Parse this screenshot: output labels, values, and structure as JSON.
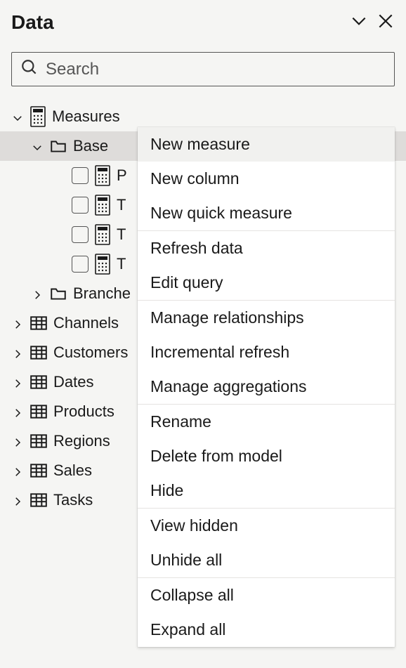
{
  "header": {
    "title": "Data"
  },
  "search": {
    "placeholder": "Search"
  },
  "tree": {
    "measures": {
      "label": "Measures",
      "base": {
        "label": "Base"
      },
      "items": [
        {
          "label": "P"
        },
        {
          "label": "T"
        },
        {
          "label": "T"
        },
        {
          "label": "T"
        }
      ],
      "branches": {
        "label": "Branche"
      }
    },
    "tables": [
      {
        "label": "Channels"
      },
      {
        "label": "Customers"
      },
      {
        "label": "Dates"
      },
      {
        "label": "Products"
      },
      {
        "label": "Regions"
      },
      {
        "label": "Sales"
      },
      {
        "label": "Tasks"
      }
    ]
  },
  "menu": {
    "groups": [
      [
        "New measure",
        "New column",
        "New quick measure"
      ],
      [
        "Refresh data",
        "Edit query"
      ],
      [
        "Manage relationships",
        "Incremental refresh",
        "Manage aggregations"
      ],
      [
        "Rename",
        "Delete from model",
        "Hide"
      ],
      [
        "View hidden",
        "Unhide all"
      ],
      [
        "Collapse all",
        "Expand all"
      ]
    ]
  }
}
